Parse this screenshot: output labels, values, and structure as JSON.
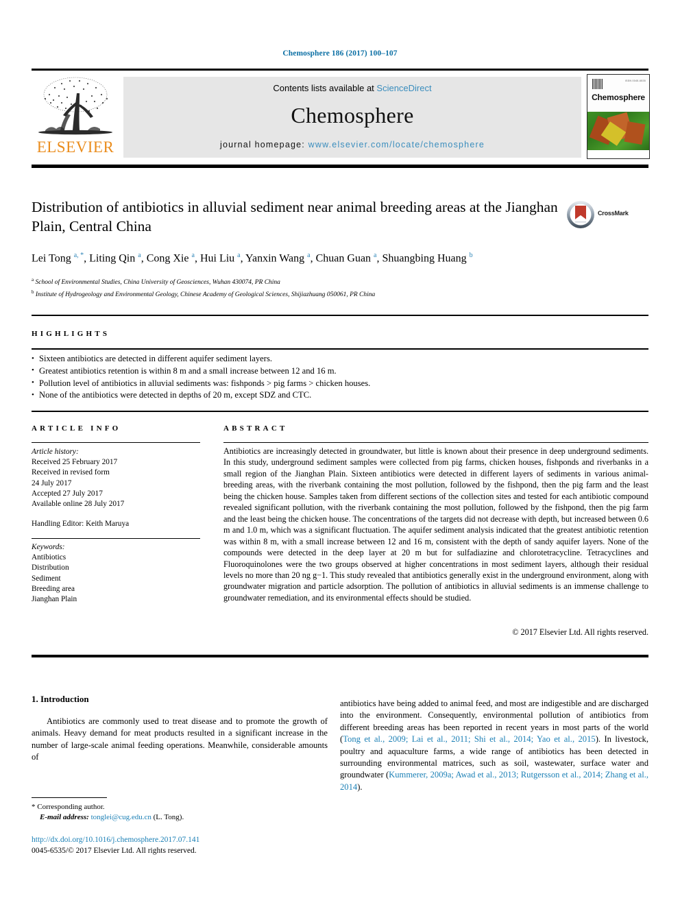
{
  "running_head": "Chemosphere 186 (2017) 100–107",
  "masthead": {
    "publisher_name": "ELSEVIER",
    "publisher_logo_name": "elsevier-tree-logo",
    "contents_prefix": "Contents lists available at ",
    "contents_link": "ScienceDirect",
    "journal_title": "Chemosphere",
    "homepage_prefix": "journal homepage: ",
    "homepage_url": "www.elsevier.com/locate/chemosphere",
    "cover": {
      "journal_name": "Chemosphere",
      "issn_text": "ISSN 0045-6535"
    }
  },
  "article": {
    "title": "Distribution of antibiotics in alluvial sediment near animal breeding areas at the Jianghan Plain, Central China",
    "authors_html": "Lei Tong <sup>a, *</sup>, Liting Qin <sup>a</sup>, Cong Xie <sup>a</sup>, Hui Liu <sup>a</sup>, Yanxin Wang <sup>a</sup>, Chuan Guan <sup>a</sup>, Shuangbing Huang <sup>b</sup>",
    "affiliation_a": "School of Environmental Studies, China University of Geosciences, Wuhan 430074, PR China",
    "affiliation_b": "Institute of Hydrogeology and Environmental Geology, Chinese Academy of Geological Sciences, Shijiazhuang 050061, PR China",
    "crossmark_label": "CrossMark"
  },
  "highlights": {
    "heading": "HIGHLIGHTS",
    "items": [
      "Sixteen antibiotics are detected in different aquifer sediment layers.",
      "Greatest antibiotics retention is within 8 m and a small increase between 12 and 16 m.",
      "Pollution level of antibiotics in alluvial sediments was: fishponds > pig farms > chicken houses.",
      "None of the antibiotics were detected in depths of 20 m, except SDZ and CTC."
    ]
  },
  "article_info": {
    "heading": "ARTICLE INFO",
    "history_label": "Article history:",
    "history_lines": [
      "Received 25 February 2017",
      "Received in revised form",
      "24 July 2017",
      "Accepted 27 July 2017",
      "Available online 28 July 2017"
    ],
    "handling_editor": "Handling Editor: Keith Maruya",
    "keywords_label": "Keywords:",
    "keywords": [
      "Antibiotics",
      "Distribution",
      "Sediment",
      "Breeding area",
      "Jianghan Plain"
    ]
  },
  "abstract": {
    "heading": "ABSTRACT",
    "text": "Antibiotics are increasingly detected in groundwater, but little is known about their presence in deep underground sediments. In this study, underground sediment samples were collected from pig farms, chicken houses, fishponds and riverbanks in a small region of the Jianghan Plain. Sixteen antibiotics were detected in different layers of sediments in various animal-breeding areas, with the riverbank containing the most pollution, followed by the fishpond, then the pig farm and the least being the chicken house. Samples taken from different sections of the collection sites and tested for each antibiotic compound revealed significant pollution, with the riverbank containing the most pollution, followed by the fishpond, then the pig farm and the least being the chicken house. The concentrations of the targets did not decrease with depth, but increased between 0.6 m and 1.0 m, which was a significant fluctuation. The aquifer sediment analysis indicated that the greatest antibiotic retention was within 8 m, with a small increase between 12 and 16 m, consistent with the depth of sandy aquifer layers. None of the compounds were detected in the deep layer at 20 m but for sulfadiazine and chlorotetracycline. Tetracyclines and Fluoroquinolones were the two groups observed at higher concentrations in most sediment layers, although their residual levels no more than 20 ng g−1. This study revealed that antibiotics generally exist in the underground environment, along with groundwater migration and particle adsorption. The pollution of antibiotics in alluvial sediments is an immense challenge to groundwater remediation, and its environmental effects should be studied.",
    "copyright": "© 2017 Elsevier Ltd. All rights reserved."
  },
  "introduction": {
    "heading": "1. Introduction",
    "paragraph_left": "Antibiotics are commonly used to treat disease and to promote the growth of animals. Heavy demand for meat products resulted in a significant increase in the number of large-scale animal feeding operations. Meanwhile, considerable amounts of",
    "paragraph_right_part1": "antibiotics have being added to animal feed, and most are indigestible and are discharged into the environment. Consequently, environmental pollution of antibiotics from different breeding areas has been reported in recent years in most parts of the world (",
    "citation_1": "Tong et al., 2009; Lai et al., 2011; Shi et al., 2014; Yao et al., 2015",
    "paragraph_right_part2": "). In livestock, poultry and aquaculture farms, a wide range of antibiotics has been detected in surrounding environmental matrices, such as soil, wastewater, surface water and groundwater (",
    "citation_2": "Kummerer, 2009a; Awad et al., 2013; Rutgersson et al., 2014; Zhang et al., 2014",
    "paragraph_right_part3": ")."
  },
  "footnote": {
    "corresponding_marker": "*",
    "corresponding_text": "Corresponding author.",
    "email_label": "E-mail address:",
    "email": "tonglei@cug.edu.cn",
    "email_suffix": "(L. Tong).",
    "doi_url": "http://dx.doi.org/10.1016/j.chemosphere.2017.07.141",
    "issn_copyright": "0045-6535/© 2017 Elsevier Ltd. All rights reserved."
  },
  "colors": {
    "link_blue": "#1a7fb5",
    "header_blue": "#0b6fa4",
    "sciencedirect_blue": "#3a8dbd",
    "elsevier_orange": "#ea8c1c",
    "crossmark_red": "#c0392b"
  }
}
